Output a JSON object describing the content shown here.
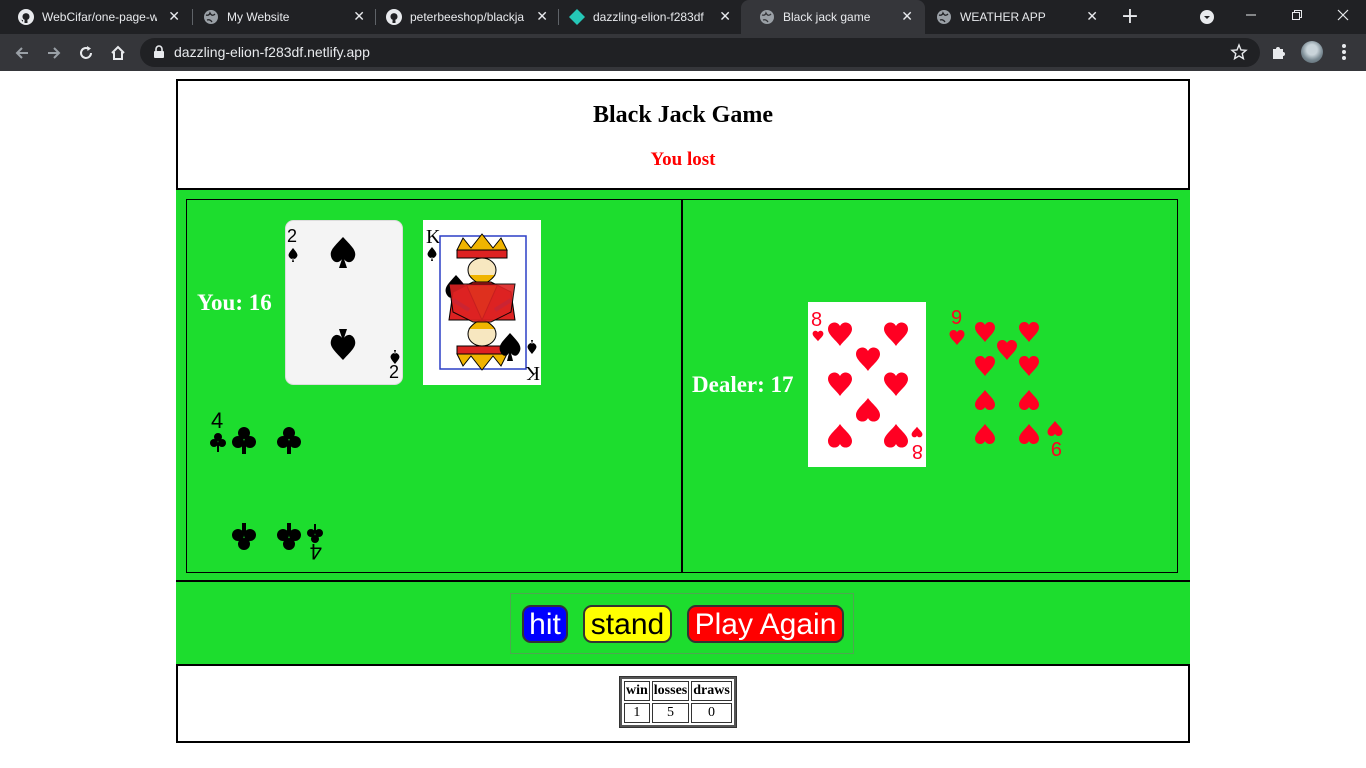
{
  "browser": {
    "tabs": [
      {
        "title": "WebCifar/one-page-w",
        "icon": "github-icon"
      },
      {
        "title": "My Website",
        "icon": "globe-icon"
      },
      {
        "title": "peterbeeshop/blackja",
        "icon": "github-icon"
      },
      {
        "title": "dazzling-elion-f283df",
        "icon": "netlify-icon"
      },
      {
        "title": "Black jack game",
        "icon": "globe-icon",
        "active": true
      },
      {
        "title": "WEATHER APP",
        "icon": "globe-icon"
      }
    ],
    "close_glyph": "✕",
    "new_tab_glyph": "+",
    "url": "dazzling-elion-f283df.netlify.app"
  },
  "game": {
    "title": "Black Jack Game",
    "result": "You lost",
    "result_color": "#ff0000",
    "felt_color": "#1ddd2e",
    "player": {
      "label": "You: 16",
      "cards": [
        {
          "rank": "2",
          "suit": "spades"
        },
        {
          "rank": "K",
          "suit": "spades"
        },
        {
          "rank": "4",
          "suit": "clubs"
        }
      ]
    },
    "dealer": {
      "label": "Dealer: 17",
      "cards": [
        {
          "rank": "8",
          "suit": "hearts"
        },
        {
          "rank": "9",
          "suit": "hearts"
        }
      ]
    },
    "buttons": {
      "hit": "hit",
      "stand": "stand",
      "play_again": "Play Again",
      "hit_color": "#0000ff",
      "stand_color": "#ffff00",
      "play_again_color": "#ff0000"
    },
    "stats": {
      "headers": [
        "win",
        "losses",
        "draws"
      ],
      "values": [
        "1",
        "5",
        "0"
      ]
    }
  }
}
